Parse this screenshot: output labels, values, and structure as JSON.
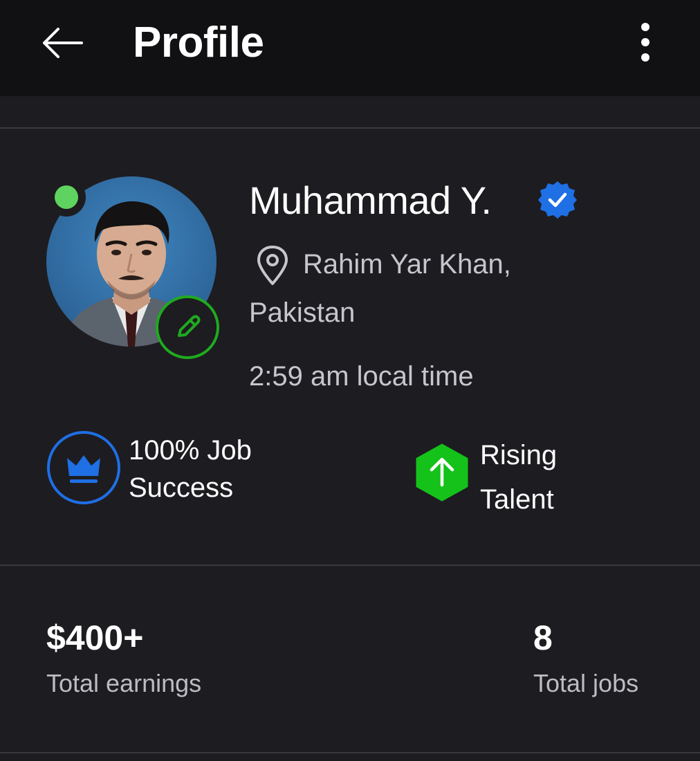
{
  "header": {
    "title": "Profile",
    "back_icon": "arrow-left-icon",
    "more_icon": "more-vertical-icon"
  },
  "profile": {
    "name": "Muhammad Y.",
    "verified_icon": "verified-badge-icon",
    "location_line1": "Rahim Yar Khan,",
    "location_line2": "Pakistan",
    "local_time": "2:59 am local time",
    "online": true,
    "online_color": "#5fd35f",
    "edit_icon": "pencil-icon"
  },
  "badges": {
    "job_success": {
      "line1": "100% Job",
      "line2": "Success",
      "icon": "crown-icon",
      "color": "#1f6fe5"
    },
    "rising_talent": {
      "line1": "Rising",
      "line2": "Talent",
      "icon": "arrow-up-icon",
      "color": "#14c21a"
    }
  },
  "stats": {
    "earnings_value": "$400+",
    "earnings_label": "Total earnings",
    "jobs_value": "8",
    "jobs_label": "Total jobs"
  },
  "colors": {
    "background": "#1d1c20",
    "header_bg": "#111113",
    "secondary_text": "#c7c6cc",
    "accent_green": "#1faa1f",
    "accent_blue": "#1f6fe5"
  }
}
